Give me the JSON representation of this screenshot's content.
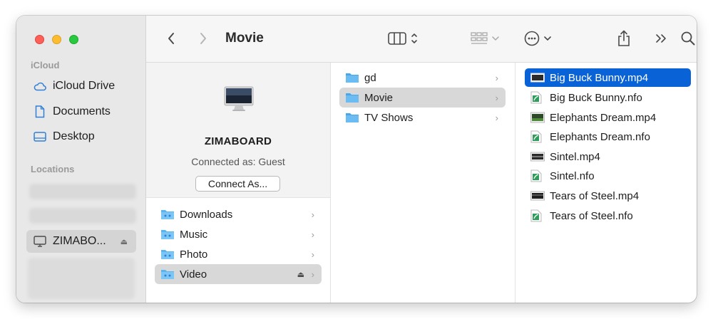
{
  "sidebar": {
    "icloud_section": "iCloud",
    "locations_section": "Locations",
    "items": [
      {
        "label": "iCloud Drive",
        "icon": "cloud-icon"
      },
      {
        "label": "Documents",
        "icon": "document-icon"
      },
      {
        "label": "Desktop",
        "icon": "desktop-icon"
      }
    ],
    "server_item": {
      "label": "ZIMABO...",
      "icon": "display-icon"
    }
  },
  "toolbar": {
    "title": "Movie"
  },
  "server_panel": {
    "name": "ZIMABOARD",
    "connected_as": "Connected as: Guest",
    "connect_button": "Connect As..."
  },
  "shares": [
    {
      "label": "Downloads"
    },
    {
      "label": "Music"
    },
    {
      "label": "Photo"
    },
    {
      "label": "Video"
    }
  ],
  "folders": [
    {
      "label": "gd"
    },
    {
      "label": "Movie"
    },
    {
      "label": "TV Shows"
    }
  ],
  "files": [
    {
      "label": "Big Buck Bunny.mp4",
      "icon": "video-file-icon"
    },
    {
      "label": "Big Buck Bunny.nfo",
      "icon": "nfo-file-icon"
    },
    {
      "label": "Elephants Dream.mp4",
      "icon": "video-file-icon"
    },
    {
      "label": "Elephants Dream.nfo",
      "icon": "nfo-file-icon"
    },
    {
      "label": "Sintel.mp4",
      "icon": "video-file-icon"
    },
    {
      "label": "Sintel.nfo",
      "icon": "nfo-file-icon"
    },
    {
      "label": "Tears of Steel.mp4",
      "icon": "video-file-icon"
    },
    {
      "label": "Tears of Steel.nfo",
      "icon": "nfo-file-icon"
    }
  ],
  "colors": {
    "selection_blue": "#0a63d6",
    "folder_blue": "#5ab4f0",
    "close": "#fe5f57",
    "minimize": "#febc2e",
    "zoom": "#28c840"
  }
}
